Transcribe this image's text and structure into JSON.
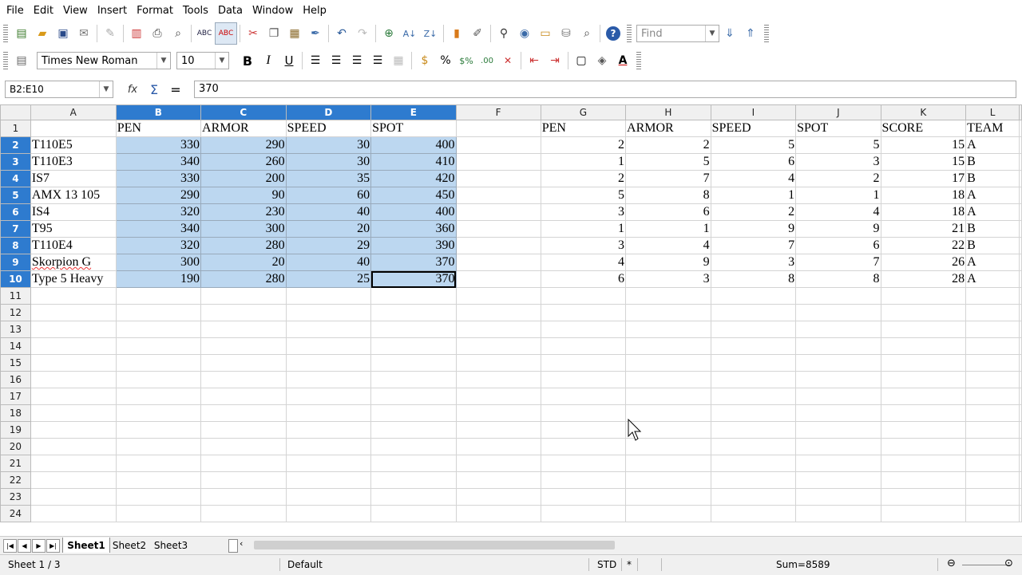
{
  "menu": [
    "File",
    "Edit",
    "View",
    "Insert",
    "Format",
    "Tools",
    "Data",
    "Window",
    "Help"
  ],
  "find": {
    "placeholder": "Find"
  },
  "format": {
    "font": "Times New Roman",
    "size": "10"
  },
  "formula": {
    "namebox": "B2:E10",
    "value": "370"
  },
  "columns": [
    "A",
    "B",
    "C",
    "D",
    "E",
    "F",
    "G",
    "H",
    "I",
    "J",
    "K",
    "L"
  ],
  "rows": [
    [
      "",
      "PEN",
      "ARMOR",
      "SPEED",
      "SPOT",
      "",
      "PEN",
      "ARMOR",
      "SPEED",
      "SPOT",
      "SCORE",
      "TEAM"
    ],
    [
      "T110E5",
      "330",
      "290",
      "30",
      "400",
      "",
      "2",
      "2",
      "5",
      "5",
      "15",
      "A"
    ],
    [
      "T110E3",
      "340",
      "260",
      "30",
      "410",
      "",
      "1",
      "5",
      "6",
      "3",
      "15",
      "B"
    ],
    [
      "IS7",
      "330",
      "200",
      "35",
      "420",
      "",
      "2",
      "7",
      "4",
      "2",
      "17",
      "B"
    ],
    [
      "AMX 13 105",
      "290",
      "90",
      "60",
      "450",
      "",
      "5",
      "8",
      "1",
      "1",
      "18",
      "A"
    ],
    [
      "IS4",
      "320",
      "230",
      "40",
      "400",
      "",
      "3",
      "6",
      "2",
      "4",
      "18",
      "A"
    ],
    [
      "T95",
      "340",
      "300",
      "20",
      "360",
      "",
      "1",
      "1",
      "9",
      "9",
      "21",
      "B"
    ],
    [
      "T110E4",
      "320",
      "280",
      "29",
      "390",
      "",
      "3",
      "4",
      "7",
      "6",
      "22",
      "B"
    ],
    [
      "Skorpion G",
      "300",
      "20",
      "40",
      "370",
      "",
      "4",
      "9",
      "3",
      "7",
      "26",
      "A"
    ],
    [
      "Type 5 Heavy",
      "190",
      "280",
      "25",
      "370",
      "",
      "6",
      "3",
      "8",
      "8",
      "28",
      "A"
    ]
  ],
  "row_count": 24,
  "sheets": [
    "Sheet1",
    "Sheet2",
    "Sheet3"
  ],
  "status": {
    "sheet": "Sheet 1 / 3",
    "style": "Default",
    "mode": "STD",
    "modified": "*",
    "sum": "Sum=8589"
  }
}
